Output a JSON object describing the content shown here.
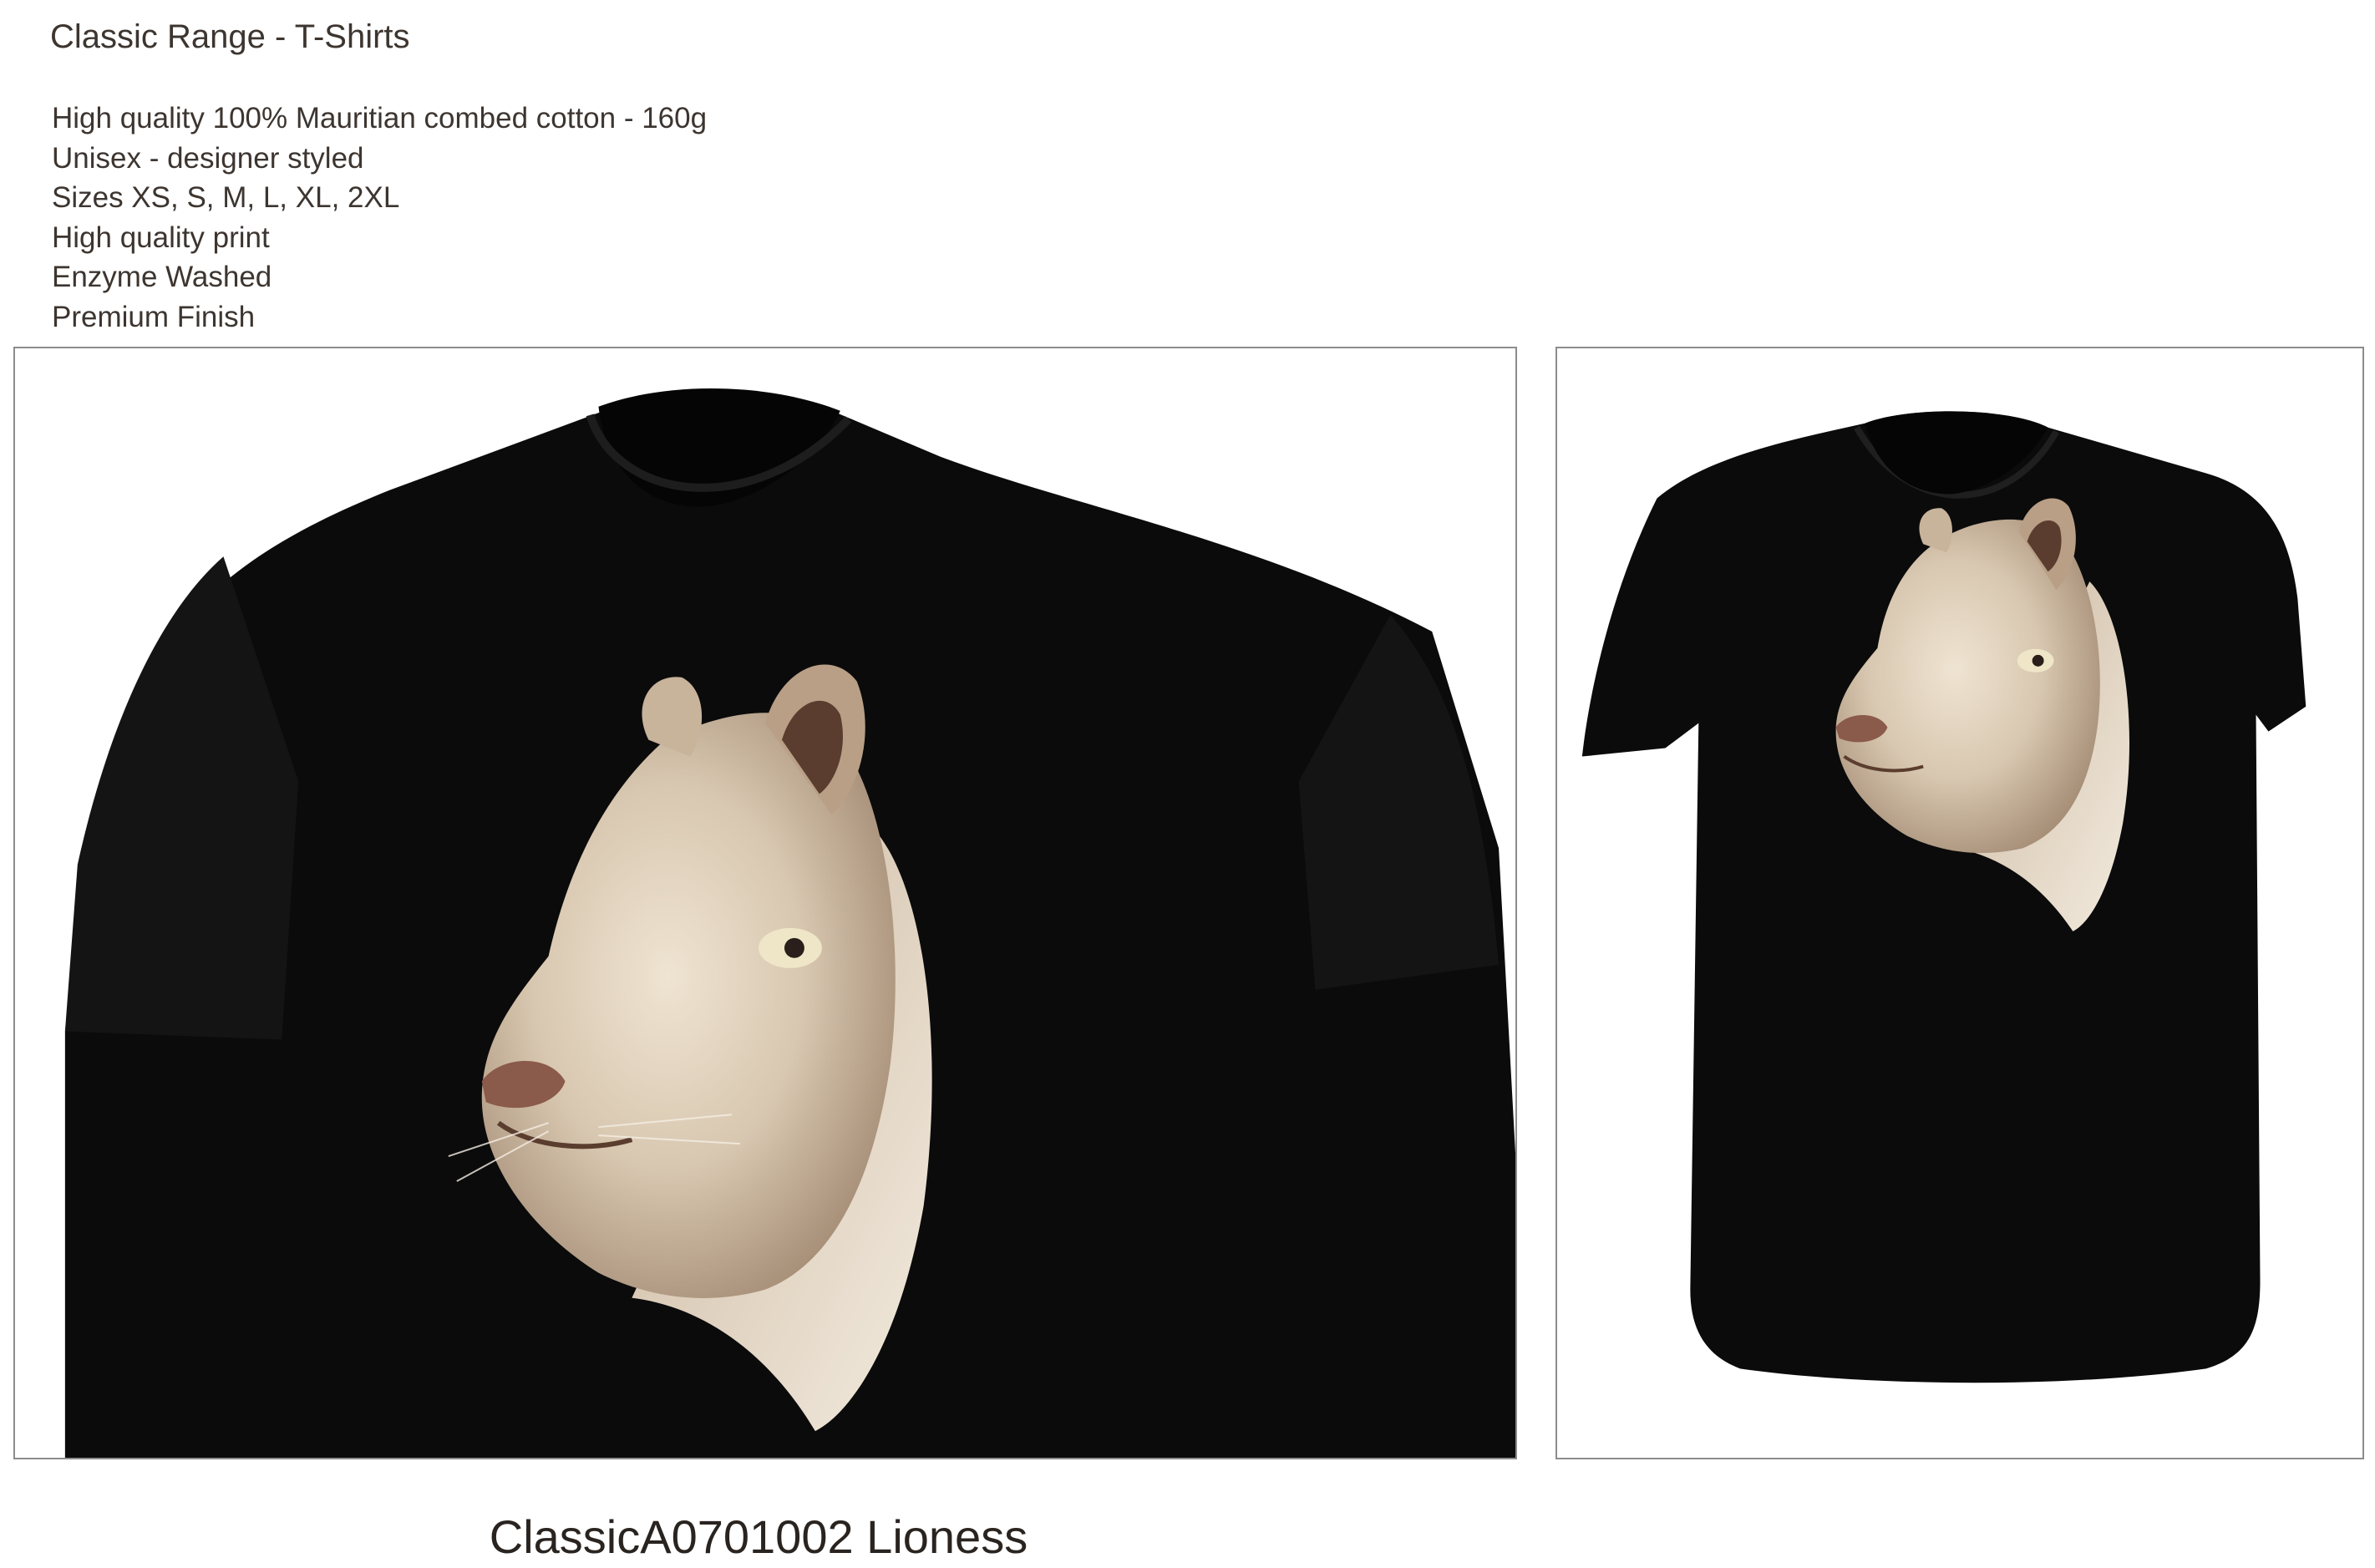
{
  "range_title": "Classic Range - T-Shirts",
  "features": [
    "High quality 100% Mauritian combed cotton - 160g",
    "Unisex - designer styled",
    "Sizes XS, S, M, L, XL, 2XL",
    "High quality print",
    "Enzyme Washed",
    "Premium Finish"
  ],
  "product": {
    "code_and_name": "ClassicA0701002 Lioness",
    "shirt_color": "#0b0b0b",
    "print_colors": [
      "#d8c7b0",
      "#efe4d2",
      "#8a6f5a"
    ]
  },
  "images": {
    "closeup_icon": "tshirt-closeup-image",
    "full_icon": "tshirt-full-image"
  }
}
